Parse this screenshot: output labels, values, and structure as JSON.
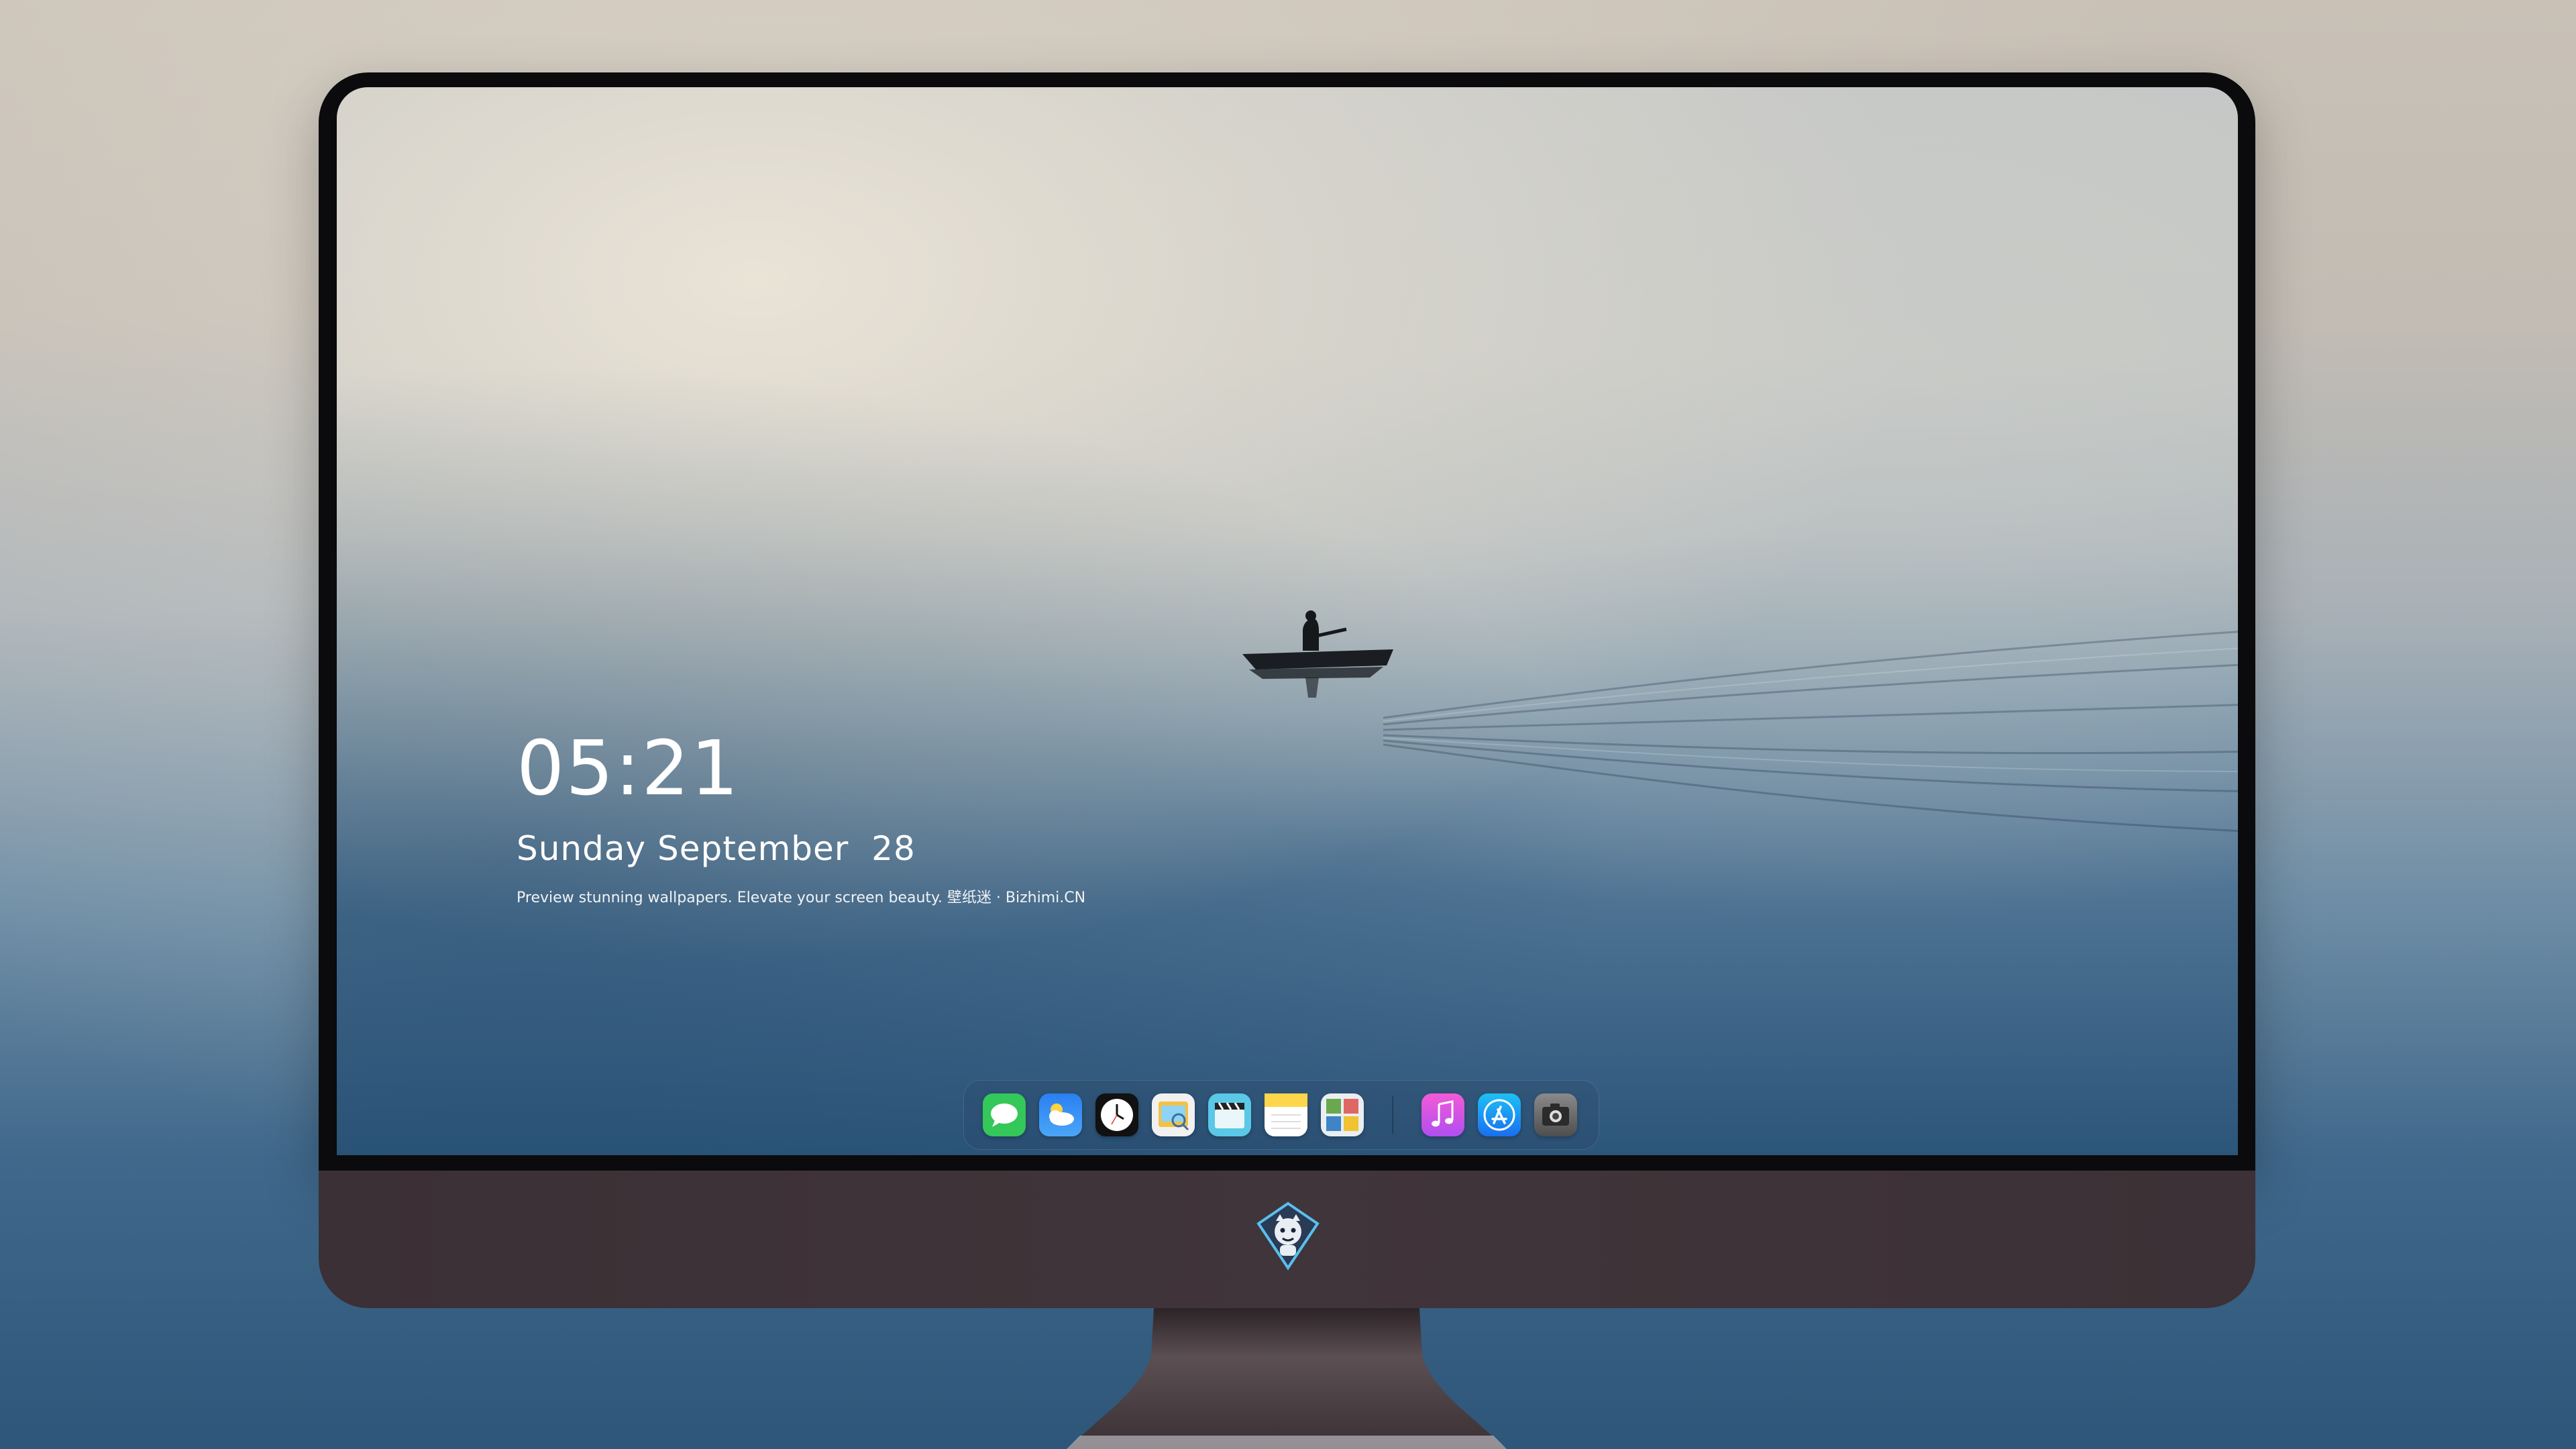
{
  "wallpaper": {
    "description_hidden": ""
  },
  "lock_screen": {
    "time": "05:21",
    "date": "Sunday September  28",
    "tagline": "Preview stunning wallpapers. Elevate your screen beauty. 壁纸迷 · Bizhimi.CN"
  },
  "dock": {
    "apps": [
      {
        "icon": "messages-icon",
        "color": "#34c759"
      },
      {
        "icon": "weather-icon",
        "color": "#2f8cf4"
      },
      {
        "icon": "clock-icon",
        "color": "#111111"
      },
      {
        "icon": "preview-icon",
        "color": "#f3c244"
      },
      {
        "icon": "clips-icon",
        "color": "#5ac8e6"
      },
      {
        "icon": "notes-icon",
        "color": "#fdd64b"
      },
      {
        "icon": "photo-gallery-icon",
        "color": "#6aa84f"
      }
    ],
    "recent_apps": [
      {
        "icon": "music-icon",
        "color": "#e24ad6"
      },
      {
        "icon": "app-store-icon",
        "color": "#1a8cf0"
      },
      {
        "icon": "camera-icon",
        "color": "#6b6b6b"
      }
    ]
  },
  "colors": {
    "monitor_bezel": "#0b0b0d",
    "monitor_chin": "#3e3338",
    "text": "#ffffff"
  }
}
